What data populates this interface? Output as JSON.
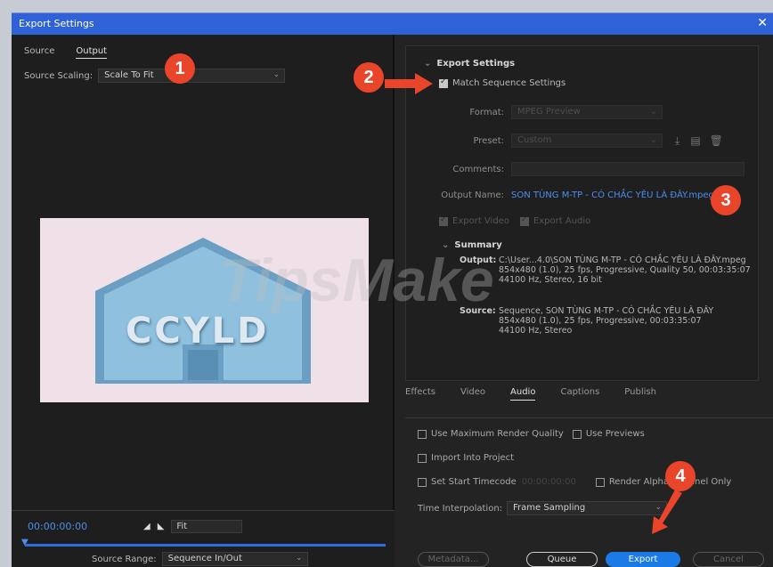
{
  "window": {
    "title": "Export Settings",
    "close": "✕"
  },
  "left": {
    "tabs": [
      "Source",
      "Output"
    ],
    "source_scaling_label": "Source Scaling:",
    "source_scaling_value": "Scale To Fit",
    "preview_text": "CCYLD",
    "timecode": "00:00:00:00",
    "zoom_value": "Fit",
    "source_range_label": "Source Range:",
    "source_range_value": "Sequence In/Out"
  },
  "export_settings": {
    "section": "Export Settings",
    "match_sequence": "Match Sequence Settings",
    "format_label": "Format:",
    "format_value": "MPEG Preview",
    "preset_label": "Preset:",
    "preset_value": "Custom",
    "comments_label": "Comments:",
    "output_name_label": "Output Name:",
    "output_name_value": "SON TÙNG M-TP - CÓ CHẮC YÊU LÀ ĐÂY.mpeg",
    "export_video": "Export Video",
    "export_audio": "Export Audio",
    "summary_section": "Summary",
    "summary_output_label": "Output:",
    "summary_output_lines": [
      "C:\\User...4.0\\SON TÙNG M-TP - CÓ CHẮC YÊU LÀ ĐÂY.mpeg",
      "854x480 (1.0), 25 fps, Progressive, Quality 50, 00:03:35:07",
      "44100 Hz, Stereo, 16 bit"
    ],
    "summary_source_label": "Source:",
    "summary_source_lines": [
      "Sequence, SON TÙNG M-TP - CÓ CHẮC YÊU LÀ ĐÂY",
      "854x480 (1.0), 25 fps, Progressive, 00:03:35:07",
      "44100 Hz, Stereo"
    ]
  },
  "tabs": [
    "Effects",
    "Video",
    "Audio",
    "Captions",
    "Publish"
  ],
  "options": {
    "max_render": "Use Maximum Render Quality",
    "use_previews": "Use Previews",
    "import_project": "Import Into Project",
    "set_start_tc": "Set Start Timecode",
    "start_tc_value": "00:00:00:00",
    "render_alpha": "Render Alpha Channel Only",
    "time_interp_label": "Time Interpolation:",
    "time_interp_value": "Frame Sampling"
  },
  "buttons": {
    "metadata": "Metadata...",
    "queue": "Queue",
    "export": "Export",
    "cancel": "Cancel"
  },
  "watermark": "TipsMake",
  "badges": [
    "1",
    "2",
    "3",
    "4"
  ],
  "colors": {
    "accent": "#1b7ae6",
    "titlebar": "#2f62d6",
    "badge": "#e8452a",
    "link": "#4b8ef0"
  }
}
